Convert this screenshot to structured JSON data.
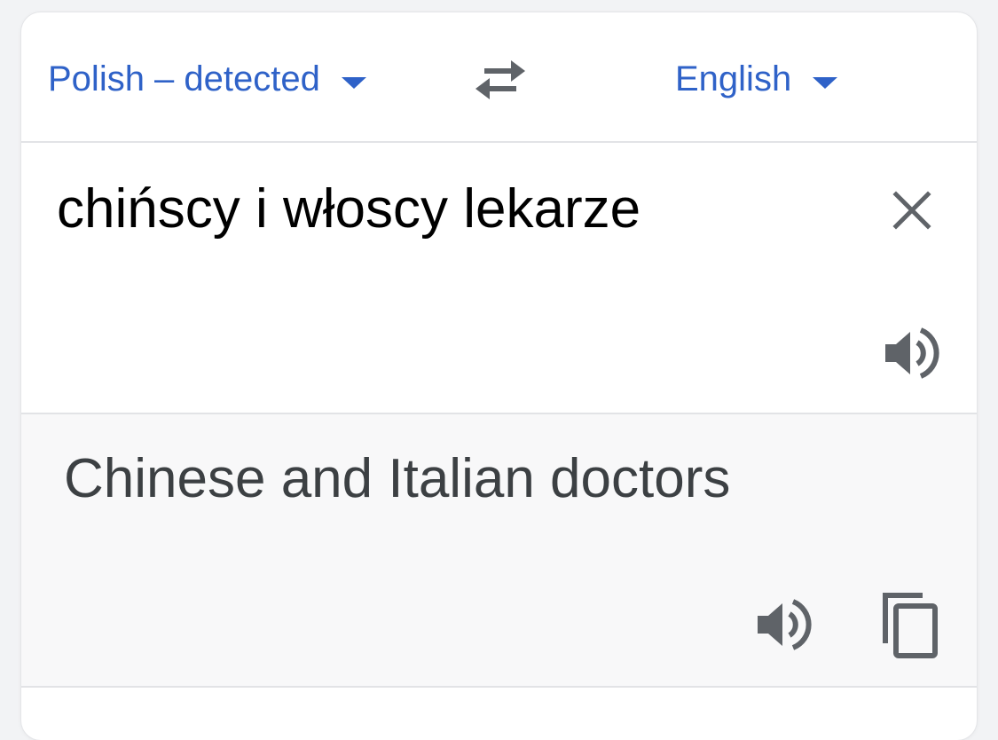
{
  "languages": {
    "source_label": "Polish – detected",
    "target_label": "English"
  },
  "input": {
    "text": "chińscy i włoscy lekarze"
  },
  "output": {
    "text": "Chinese and Italian doctors"
  },
  "icons": {
    "swap": "swap-arrows-icon",
    "clear": "close-icon",
    "speaker": "speaker-icon",
    "copy": "copy-icon"
  },
  "colors": {
    "accent": "#2f62c8",
    "icon": "#5f6368",
    "result_text": "#3c4043",
    "result_bg": "#f8f8f9"
  }
}
